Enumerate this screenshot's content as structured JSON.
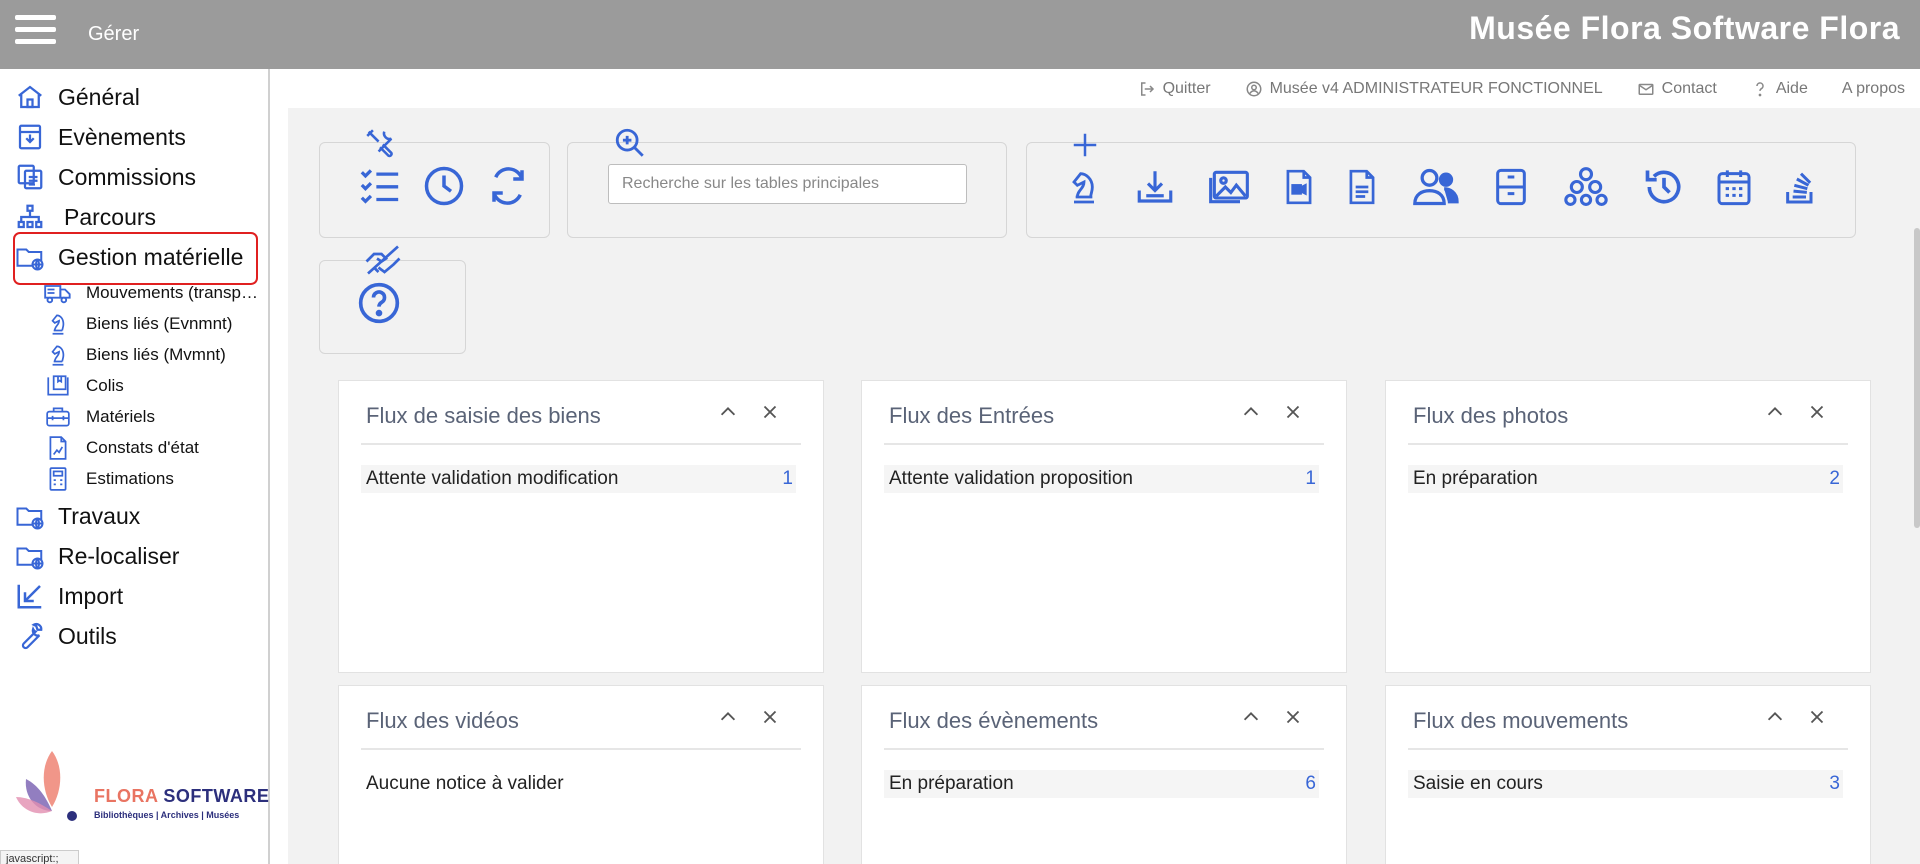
{
  "header": {
    "menu_label": "Gérer",
    "app_title": "Musée Flora Software Flora",
    "links": {
      "quit": "Quitter",
      "user": "Musée v4 ADMINISTRATEUR FONCTIONNEL",
      "contact": "Contact",
      "help": "Aide",
      "about": "A propos"
    }
  },
  "sidebar": {
    "items": {
      "general": "Général",
      "events": "Evènements",
      "commissions": "Commissions",
      "paths": "Parcours",
      "material": "Gestion matérielle",
      "works": "Travaux",
      "relocate": "Re-localiser",
      "import": "Import",
      "tools": "Outils"
    },
    "subitems": {
      "movements": "Mouvements (transp…",
      "linked_events": "Biens liés (Evnmnt)",
      "linked_movements": "Biens liés (Mvmnt)",
      "parcels": "Colis",
      "equipment": "Matériels",
      "condition_reports": "Constats d'état",
      "estimates": "Estimations"
    },
    "logo": {
      "name_part1": "FLORA",
      "name_part2": "SOFTWARE",
      "tagline": "Bibliothèques | Archives | Musées"
    }
  },
  "search": {
    "placeholder": "Recherche sur les tables principales"
  },
  "panels": {
    "p1": {
      "title": "Flux de saisie des biens",
      "row_label": "Attente validation modification",
      "row_count": "1"
    },
    "p2": {
      "title": "Flux des Entrées",
      "row_label": "Attente validation proposition",
      "row_count": "1"
    },
    "p3": {
      "title": "Flux des photos",
      "row_label": "En préparation",
      "row_count": "2"
    },
    "p4": {
      "title": "Flux des vidéos",
      "row_label": "Aucune notice à valider",
      "row_count": ""
    },
    "p5": {
      "title": "Flux des évènements",
      "row_label": "En préparation",
      "row_count": "6"
    },
    "p6": {
      "title": "Flux des mouvements",
      "row_label": "Saisie en cours",
      "row_count": "3"
    }
  },
  "status_tip": "javascript:;",
  "colors": {
    "topbar": "#9b9b9b",
    "icon_blue": "#3866d6",
    "highlight": "#e02020",
    "panel_title": "#5a6377"
  }
}
